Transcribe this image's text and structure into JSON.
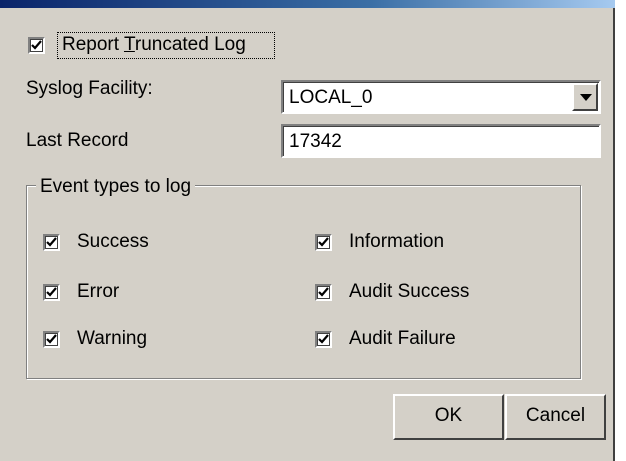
{
  "options": {
    "report_truncated_log": {
      "checked": true,
      "label_pre": "Report ",
      "label_accel": "T",
      "label_post": "runcated Log"
    }
  },
  "syslog_facility": {
    "label": "Syslog Facility:",
    "value": "LOCAL_0"
  },
  "last_record": {
    "label": "Last Record",
    "value": "17342"
  },
  "event_types": {
    "legend": "Event types to log",
    "success": {
      "label": "Success",
      "checked": true
    },
    "error": {
      "label": "Error",
      "checked": true
    },
    "warning": {
      "label": "Warning",
      "checked": true
    },
    "information": {
      "label": "Information",
      "checked": true
    },
    "audit_success": {
      "label": "Audit Success",
      "checked": true
    },
    "audit_failure": {
      "label": "Audit Failure",
      "checked": true
    }
  },
  "buttons": {
    "ok": "OK",
    "cancel": "Cancel"
  },
  "colors": {
    "face": "#d4d0c8",
    "shadow": "#808080",
    "title_blue": "#0a246a"
  }
}
